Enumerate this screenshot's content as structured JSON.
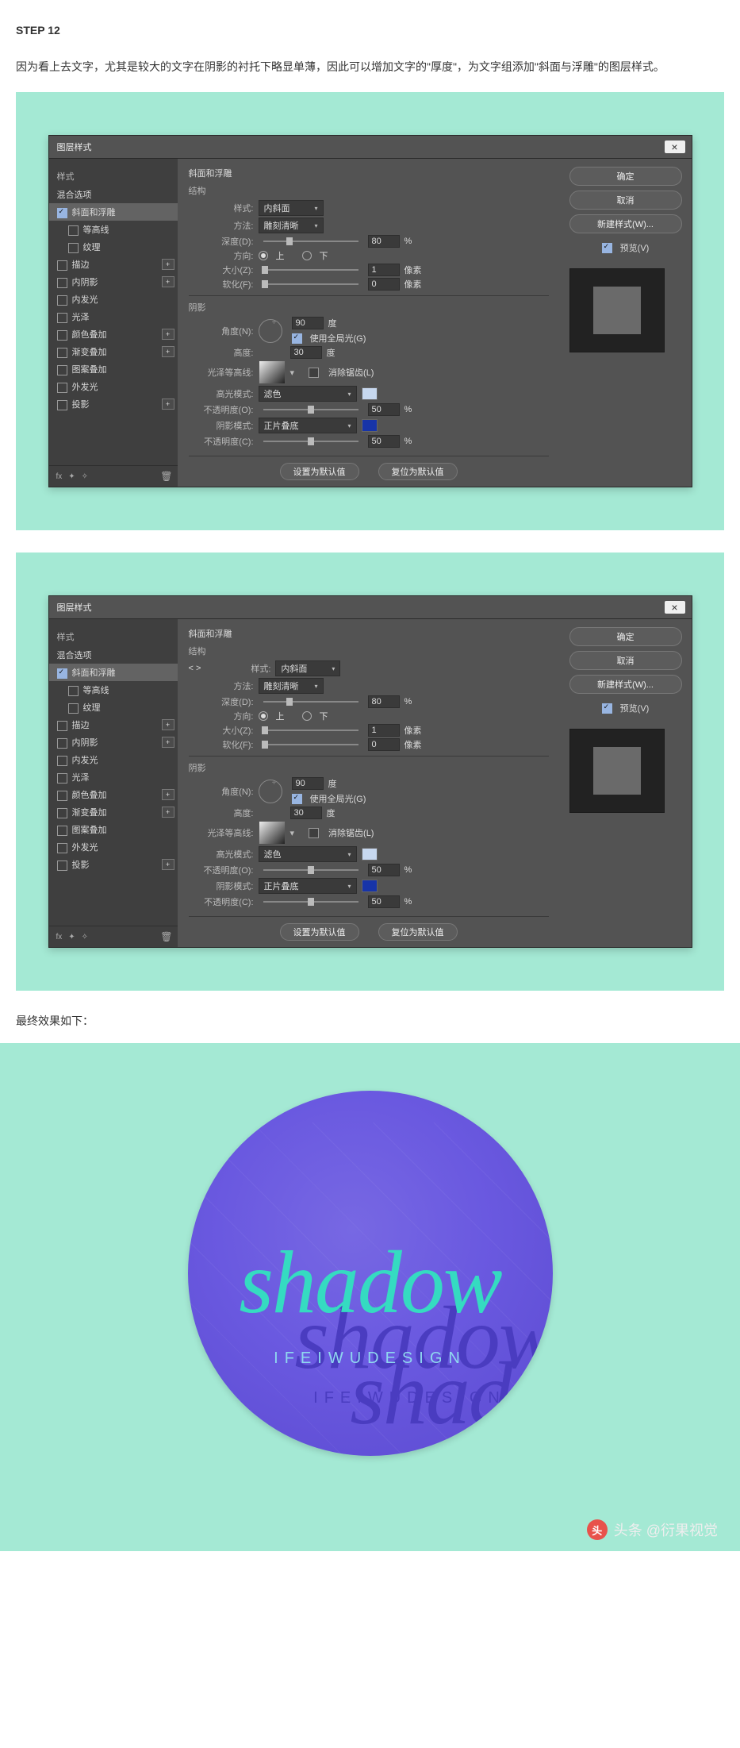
{
  "step_label": "STEP 12",
  "desc": "因为看上去文字，尤其是较大的文字在阴影的衬托下略显单薄，因此可以增加文字的\"厚度\"，为文字组添加\"斜面与浮雕\"的图层样式。",
  "dialog": {
    "title": "图层样式",
    "ok": "确定",
    "cancel": "取消",
    "newstyle": "新建样式(W)...",
    "preview": "预览(V)",
    "defaults_set": "设置为默认值",
    "defaults_reset": "复位为默认值",
    "left": {
      "styles": "样式",
      "blend": "混合选项",
      "bevel": "斜面和浮雕",
      "contour": "等高线",
      "texture": "纹理",
      "stroke": "描边",
      "inner_shadow": "内阴影",
      "inner_glow": "内发光",
      "satin": "光泽",
      "color_overlay": "颜色叠加",
      "gradient_overlay": "渐变叠加",
      "pattern_overlay": "图案叠加",
      "outer_glow": "外发光",
      "drop_shadow": "投影"
    },
    "mid": {
      "section": "斜面和浮雕",
      "structure": "结构",
      "style_lbl": "样式:",
      "style_val": "内斜面",
      "method_lbl": "方法:",
      "method_val": "雕刻清晰",
      "depth_lbl": "深度(D):",
      "depth_val": "80",
      "depth_unit": "%",
      "dir_lbl": "方向:",
      "dir_up": "上",
      "dir_down": "下",
      "size_lbl": "大小(Z):",
      "size_val": "1",
      "size_unit": "像素",
      "soften_lbl": "软化(F):",
      "soften_val": "0",
      "soften_unit": "像素",
      "shadow_hdr": "阴影",
      "angle_lbl": "角度(N):",
      "angle_val": "90",
      "deg": "度",
      "global": "使用全局光(G)",
      "alt_lbl": "高度:",
      "alt_val": "30",
      "gloss_lbl": "光泽等高线:",
      "antialias": "消除锯齿(L)",
      "hl_mode_lbl": "高光模式:",
      "hl_mode_val": "滤色",
      "hl_opac_lbl": "不透明度(O):",
      "hl_opac_val": "50",
      "hl_opac_unit": "%",
      "sh_mode_lbl": "阴影模式:",
      "sh_mode_val": "正片叠底",
      "sh_opac_lbl": "不透明度(C):",
      "sh_opac_val": "50",
      "sh_opac_unit": "%"
    }
  },
  "final_label": "最终效果如下：",
  "final": {
    "main": "shadow",
    "sub": "IFEIWUDESIGN"
  },
  "attribution": "头条 @衍果视觉"
}
